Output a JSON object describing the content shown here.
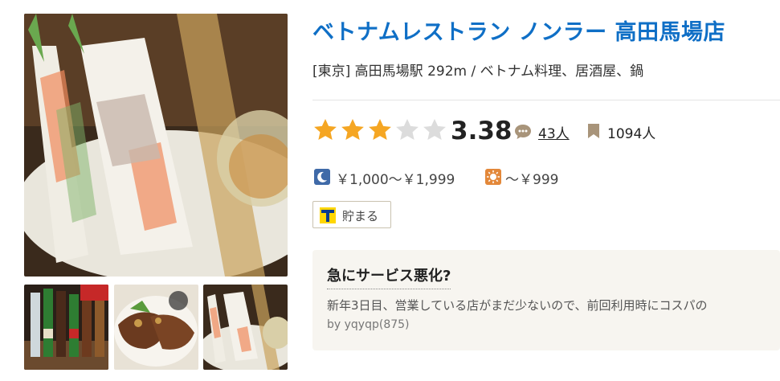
{
  "restaurant": {
    "name": "ベトナムレストラン ノンラー 高田馬場店",
    "area_station": "[東京] 高田馬場駅 292m / ベトナム料理、居酒屋、鍋"
  },
  "rating": {
    "stars_filled": 3,
    "stars_total": 5,
    "score": "3.38",
    "review_count": "43人",
    "saved_count": "1094人",
    "colors": {
      "star_on": "#f5a623",
      "star_off": "#dcdcdc"
    }
  },
  "budget": {
    "dinner": "￥1,000～￥1,999",
    "lunch": "～￥999"
  },
  "tpoint": {
    "label": "貯まる"
  },
  "review": {
    "title": "急にサービス悪化?",
    "snippet": "新年3日目、営業している店がまだ少ないので、前回利用時にコスパの",
    "author": "by yqyqp(875)"
  },
  "icons": {
    "review": "speech-bubble-icon",
    "saved": "bookmark-icon",
    "dinner": "moon-icon",
    "lunch": "sun-icon",
    "tpoint": "tpoint-logo-icon"
  },
  "photos": {
    "main": "spring-rolls-photo",
    "thumbs": [
      "beer-bottles-photo",
      "grilled-meat-photo",
      "spring-rolls-photo"
    ]
  },
  "theme": {
    "title_color": "#0f6fc6",
    "card_bg": "#f7f5f0"
  }
}
